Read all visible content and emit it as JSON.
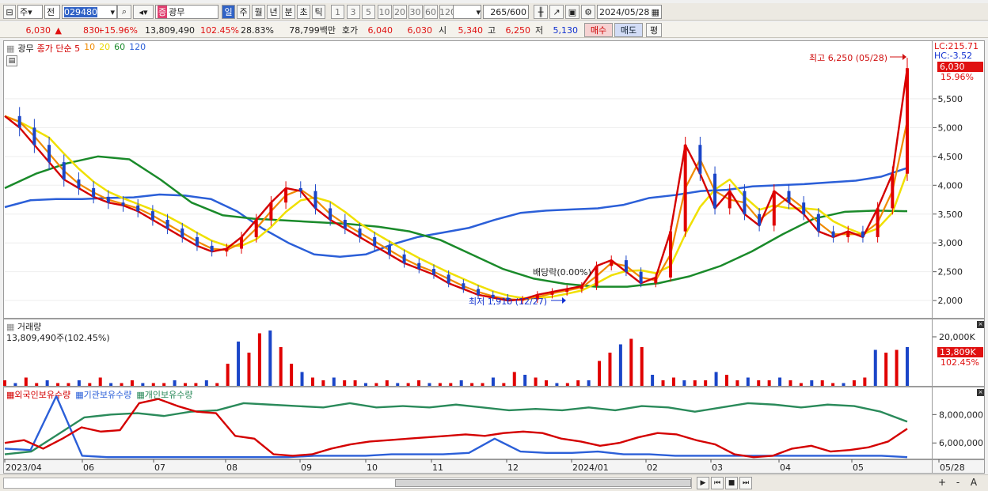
{
  "toolbar": {
    "mode": "주",
    "jeon": "전",
    "code": "029480",
    "name_badge": "증",
    "name": "광무",
    "periods": [
      "일",
      "주",
      "월",
      "년",
      "분",
      "초",
      "틱"
    ],
    "active_period": "일",
    "intervals": [
      "1",
      "3",
      "5",
      "10",
      "20",
      "30",
      "60",
      "120"
    ],
    "count": "265",
    "count_total": "/600",
    "date": "2024/05/28"
  },
  "quote": {
    "price": "6,030",
    "change_arrow": "▲",
    "change": "830",
    "change_pct": "+15.96%",
    "volume": "13,809,490",
    "vol_ratio": "102.45%",
    "turnover": "28.83%",
    "amount": "78,799백만",
    "hoga_label": "호가",
    "ask": "6,040",
    "bid": "6,030",
    "open_label": "시",
    "open": "5,340",
    "high_label": "고",
    "high": "6,250",
    "low_label": "저",
    "low": "5,130",
    "buy": "매수",
    "sell": "매도",
    "eval": "평"
  },
  "price_panel": {
    "tag": "광무",
    "legend": [
      {
        "label": "종가 단순 5",
        "color": "#d40000"
      },
      {
        "label": "10",
        "color": "#f08a00"
      },
      {
        "label": "20",
        "color": "#e8d800"
      },
      {
        "label": "60",
        "color": "#1a8a2a"
      },
      {
        "label": "120",
        "color": "#2b5fd8"
      }
    ],
    "lc": "LC:215.71",
    "hc": "HC:-3.52",
    "cur_price_tag": "6,030",
    "cur_pct_tag": "15.96%",
    "max_note": "최고 6,250 (05/28)",
    "min_note": "최저 1,910 (12/27)",
    "dividend_note": "배당락(0.00%)"
  },
  "volume_panel": {
    "title": "거래량",
    "value_line": "13,809,490주(102.45%)",
    "axis_top": "20,000K",
    "cur_tag": "13,809K",
    "cur_pct": "102.45%"
  },
  "holding_panel": {
    "legend": [
      {
        "label": "외국인보유수량",
        "color": "#d40000"
      },
      {
        "label": "기관보유수량",
        "color": "#2b5fd8"
      },
      {
        "label": "개인보유수량",
        "color": "#2a8a5a"
      }
    ]
  },
  "chart_data": {
    "type": "candlestick",
    "price_axis": {
      "ticks": [
        "5,500",
        "5,000",
        "4,500",
        "4,000",
        "3,500",
        "3,000",
        "2,500",
        "2,000"
      ],
      "range": [
        1700,
        6500
      ]
    },
    "volume_axis": {
      "ticks": [
        "20,000K"
      ]
    },
    "holding_axis": {
      "ticks": [
        "8,000,000",
        "6,000,000"
      ],
      "range": [
        4900000,
        9800000
      ]
    },
    "x_labels": [
      "2023/04",
      "06",
      "07",
      "08",
      "09",
      "10",
      "11",
      "12",
      "2024/01",
      "02",
      "03",
      "04",
      "05",
      "05/28"
    ],
    "close_series": [
      5200,
      5000,
      4700,
      4400,
      4100,
      3950,
      3800,
      3700,
      3650,
      3550,
      3400,
      3250,
      3100,
      2950,
      2850,
      2900,
      3100,
      3400,
      3700,
      3950,
      3900,
      3600,
      3400,
      3250,
      3100,
      2950,
      2800,
      2650,
      2550,
      2450,
      2300,
      2200,
      2100,
      2050,
      2000,
      2020,
      2100,
      2150,
      2200,
      2250,
      2600,
      2700,
      2500,
      2300,
      2400,
      3200,
      4700,
      4200,
      3600,
      3900,
      3500,
      3300,
      3900,
      3700,
      3500,
      3200,
      3100,
      3200,
      3100,
      3600,
      4200,
      6030
    ],
    "ma60_series": [
      3950,
      4200,
      4380,
      4500,
      4450,
      4100,
      3700,
      3480,
      3420,
      3390,
      3360,
      3330,
      3280,
      3200,
      3050,
      2800,
      2550,
      2380,
      2290,
      2240,
      2240,
      2300,
      2420,
      2600,
      2850,
      3150,
      3420,
      3540,
      3560,
      3550
    ],
    "ma120_series": [
      3620,
      3740,
      3760,
      3760,
      3780,
      3790,
      3840,
      3820,
      3760,
      3550,
      3250,
      3000,
      2800,
      2760,
      2800,
      2970,
      3100,
      3180,
      3260,
      3400,
      3520,
      3560,
      3580,
      3600,
      3660,
      3780,
      3830,
      3900,
      3920,
      3980,
      4000,
      4020,
      4050,
      4080,
      4150,
      4300
    ],
    "volume_series": [
      2,
      1,
      3,
      1,
      2,
      1,
      1,
      2,
      1,
      3,
      1,
      1,
      2,
      1,
      1,
      1,
      2,
      1,
      1,
      2,
      1,
      8,
      16,
      12,
      19,
      20,
      14,
      8,
      5,
      3,
      2,
      3,
      2,
      2,
      1,
      1,
      2,
      1,
      1,
      2,
      1,
      1,
      1,
      2,
      1,
      1,
      3,
      1,
      5,
      4,
      3,
      2,
      1,
      1,
      2,
      2,
      9,
      12,
      15,
      17,
      14,
      4,
      2,
      3,
      2,
      2,
      2,
      5,
      4,
      2,
      3,
      2,
      2,
      3,
      2,
      1,
      2,
      2,
      1,
      1,
      2,
      3,
      13,
      12,
      13,
      14
    ],
    "foreign_holding": [
      6000000,
      6200000,
      5600000,
      6300000,
      7100000,
      6800000,
      6900000,
      8800000,
      9100000,
      8600000,
      8200000,
      8100000,
      6500000,
      6300000,
      5200000,
      5100000,
      5200000,
      5600000,
      5900000,
      6100000,
      6200000,
      6300000,
      6400000,
      6500000,
      6600000,
      6500000,
      6700000,
      6800000,
      6700000,
      6300000,
      6100000,
      5800000,
      6000000,
      6400000,
      6700000,
      6600000,
      6200000,
      5900000,
      5200000,
      5000000,
      5100000,
      5600000,
      5800000,
      5400000,
      5500000,
      5700000,
      6100000,
      7000000
    ],
    "institution_holding": [
      5600000,
      5500000,
      9300000,
      5100000,
      5000000,
      5000000,
      5000000,
      5000000,
      5000000,
      5000000,
      5000000,
      5000000,
      5100000,
      5100000,
      5100000,
      5200000,
      5200000,
      5200000,
      5300000,
      6300000,
      5400000,
      5300000,
      5300000,
      5400000,
      5200000,
      5200000,
      5100000,
      5100000,
      5100000,
      5100000,
      5100000,
      5100000,
      5100000,
      5100000,
      5100000,
      5000000
    ],
    "individual_holding": [
      5200000,
      5400000,
      6600000,
      7800000,
      8000000,
      8100000,
      7900000,
      8200000,
      8300000,
      8800000,
      8700000,
      8600000,
      8500000,
      8800000,
      8500000,
      8600000,
      8500000,
      8700000,
      8500000,
      8300000,
      8400000,
      8300000,
      8500000,
      8300000,
      8600000,
      8500000,
      8200000,
      8500000,
      8800000,
      8700000,
      8500000,
      8700000,
      8600000,
      8200000,
      7500000
    ]
  },
  "bottom": {
    "controls": [
      "▶",
      "⏮",
      "■",
      "⏭",
      "+",
      "-",
      "A"
    ]
  }
}
